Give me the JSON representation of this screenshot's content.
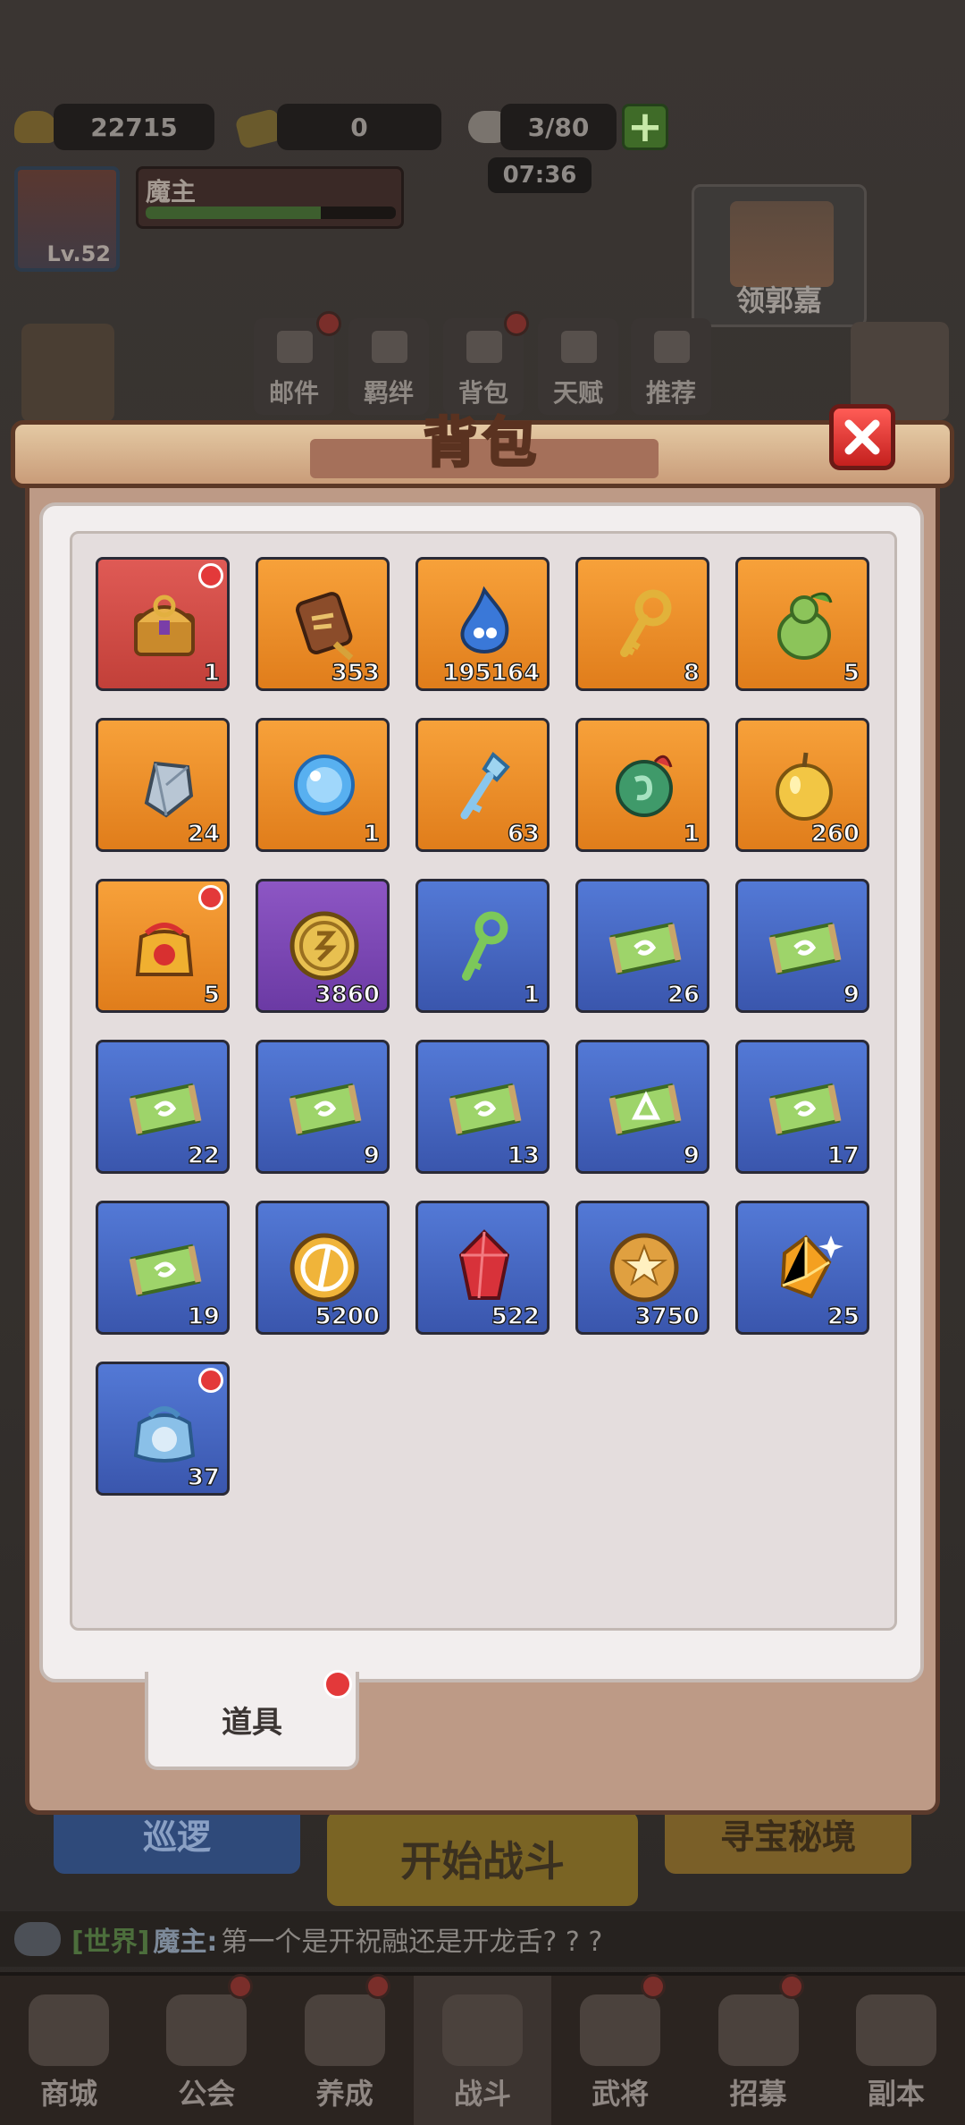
{
  "resources": {
    "gold": "22715",
    "coupon": "0",
    "stamina": "3/80",
    "timer": "07:36"
  },
  "player": {
    "level": "Lv.52",
    "name": "魔主"
  },
  "npc": {
    "label": "领郭嘉"
  },
  "features": [
    "邮件",
    "羁绊",
    "背包",
    "天赋",
    "推荐"
  ],
  "lower_buttons": {
    "patrol": "巡逻",
    "start_battle": "开始战斗",
    "treasure": "寻宝秘境"
  },
  "chat": {
    "channel": "[世界]",
    "user": "魔主:",
    "message": "第一个是开祝融还是开龙舌? ? ?"
  },
  "bottom_nav": [
    "商城",
    "公会",
    "养成",
    "战斗",
    "武将",
    "招募",
    "副本"
  ],
  "modal": {
    "title": "背包",
    "tab_label": "道具"
  },
  "items": [
    {
      "name": "treasure-chest",
      "rarity": "red",
      "qty": "1",
      "badge": true
    },
    {
      "name": "wooden-token",
      "rarity": "orange",
      "qty": "353",
      "badge": false
    },
    {
      "name": "blue-flame",
      "rarity": "orange",
      "qty": "195164",
      "badge": false
    },
    {
      "name": "gold-key",
      "rarity": "orange",
      "qty": "8",
      "badge": false
    },
    {
      "name": "green-gourd",
      "rarity": "orange",
      "qty": "5",
      "badge": false
    },
    {
      "name": "silver-stone",
      "rarity": "orange",
      "qty": "24",
      "badge": false
    },
    {
      "name": "blue-orb",
      "rarity": "orange",
      "qty": "1",
      "badge": false
    },
    {
      "name": "crystal-key",
      "rarity": "orange",
      "qty": "63",
      "badge": false
    },
    {
      "name": "jade-pendant",
      "rarity": "orange",
      "qty": "1",
      "badge": false
    },
    {
      "name": "golden-apple",
      "rarity": "orange",
      "qty": "260",
      "badge": false
    },
    {
      "name": "gift-pouch",
      "rarity": "orange",
      "qty": "5",
      "badge": true
    },
    {
      "name": "gold-coin",
      "rarity": "purple",
      "qty": "3860",
      "badge": false
    },
    {
      "name": "green-key",
      "rarity": "blue",
      "qty": "1",
      "badge": false
    },
    {
      "name": "scroll",
      "rarity": "blue",
      "qty": "26",
      "badge": false
    },
    {
      "name": "scroll",
      "rarity": "blue",
      "qty": "9",
      "badge": false
    },
    {
      "name": "scroll",
      "rarity": "blue",
      "qty": "22",
      "badge": false
    },
    {
      "name": "scroll",
      "rarity": "blue",
      "qty": "9",
      "badge": false
    },
    {
      "name": "scroll",
      "rarity": "blue",
      "qty": "13",
      "badge": false
    },
    {
      "name": "scroll-triangle",
      "rarity": "blue",
      "qty": "9",
      "badge": false
    },
    {
      "name": "scroll",
      "rarity": "blue",
      "qty": "17",
      "badge": false
    },
    {
      "name": "scroll",
      "rarity": "blue",
      "qty": "19",
      "badge": false
    },
    {
      "name": "sword-coin",
      "rarity": "blue",
      "qty": "5200",
      "badge": false
    },
    {
      "name": "red-crystal",
      "rarity": "blue",
      "qty": "522",
      "badge": false
    },
    {
      "name": "star-medal",
      "rarity": "blue",
      "qty": "3750",
      "badge": false
    },
    {
      "name": "amber-gem",
      "rarity": "blue",
      "qty": "25",
      "badge": false
    },
    {
      "name": "blue-pouch",
      "rarity": "blue",
      "qty": "37",
      "badge": true
    }
  ],
  "colors": {
    "rarity_red": "#d24e48",
    "rarity_orange": "#ee8f2b",
    "rarity_purple": "#7c48b4",
    "rarity_blue": "#4667c2",
    "badge": "#e3393a",
    "close_button": "#e23a36"
  }
}
